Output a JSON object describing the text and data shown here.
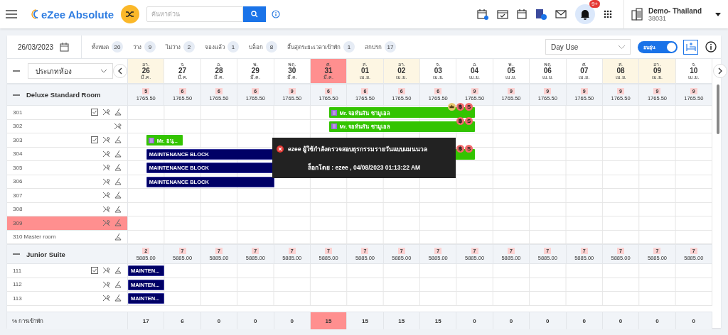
{
  "header": {
    "logo": "eZee Absolute",
    "search": {
      "placeholder": "ค้นหาด่วน"
    },
    "notifications": "9+",
    "property": {
      "name": "Demo- Thailand",
      "code": "38031"
    }
  },
  "toolbar": {
    "date": "26/03/2023",
    "stats": [
      {
        "label": "ทั้งหมด",
        "count": "20"
      },
      {
        "label": "ว่าง",
        "count": "9"
      },
      {
        "label": "ไม่ว่าง",
        "count": "2"
      },
      {
        "label": "จองแล้ว",
        "count": "1"
      },
      {
        "label": "บล็อก",
        "count": "8"
      },
      {
        "label": "สิ้นสุดระยะเวลาเข้าพัก",
        "count": "1"
      },
      {
        "label": "สกปรก",
        "count": "17"
      }
    ],
    "view": "Day Use",
    "toggle": {
      "label": "อบอุ่น",
      "on": true
    }
  },
  "room_type_filter": "ประเภทห้อง",
  "days": [
    {
      "dow": "อา.",
      "day": "26",
      "month": "มี.ค.",
      "weekend": true,
      "highlighted": false
    },
    {
      "dow": "จ.",
      "day": "27",
      "month": "มี.ค.",
      "weekend": false,
      "highlighted": false
    },
    {
      "dow": "อ.",
      "day": "28",
      "month": "มี.ค.",
      "weekend": false,
      "highlighted": false
    },
    {
      "dow": "พ.",
      "day": "29",
      "month": "มี.ค.",
      "weekend": false,
      "highlighted": false
    },
    {
      "dow": "พฤ.",
      "day": "30",
      "month": "มี.ค.",
      "weekend": false,
      "highlighted": false
    },
    {
      "dow": "ศ.",
      "day": "31",
      "month": "มี.ค.",
      "weekend": false,
      "highlighted": true
    },
    {
      "dow": "ส.",
      "day": "01",
      "month": "เม.ย.",
      "weekend": true,
      "highlighted": false
    },
    {
      "dow": "อา.",
      "day": "02",
      "month": "เม.ย.",
      "weekend": true,
      "highlighted": false
    },
    {
      "dow": "จ.",
      "day": "03",
      "month": "เม.ย.",
      "weekend": false,
      "highlighted": false
    },
    {
      "dow": "อ.",
      "day": "04",
      "month": "เม.ย.",
      "weekend": false,
      "highlighted": false
    },
    {
      "dow": "พ.",
      "day": "05",
      "month": "เม.ย.",
      "weekend": false,
      "highlighted": false
    },
    {
      "dow": "พฤ.",
      "day": "06",
      "month": "เม.ย.",
      "weekend": false,
      "highlighted": false
    },
    {
      "dow": "ศ.",
      "day": "07",
      "month": "เม.ย.",
      "weekend": false,
      "highlighted": false
    },
    {
      "dow": "ส.",
      "day": "08",
      "month": "เม.ย.",
      "weekend": true,
      "highlighted": false
    },
    {
      "dow": "อา.",
      "day": "09",
      "month": "เม.ย.",
      "weekend": true,
      "highlighted": false
    },
    {
      "dow": "จ.",
      "day": "10",
      "month": "เม.ย.",
      "weekend": false,
      "highlighted": false
    }
  ],
  "sections": [
    {
      "name": "Deluxe Standard Room",
      "expanded": true,
      "availability": [
        {
          "count": "5",
          "rate": "1765.50"
        },
        {
          "count": "6",
          "rate": "1765.50"
        },
        {
          "count": "6",
          "rate": "1765.50"
        },
        {
          "count": "6",
          "rate": "1765.50"
        },
        {
          "count": "9",
          "rate": "1765.50"
        },
        {
          "count": "6",
          "rate": "1765.50"
        },
        {
          "count": "6",
          "rate": "1765.50"
        },
        {
          "count": "6",
          "rate": "1765.50"
        },
        {
          "count": "6",
          "rate": "1765.50"
        },
        {
          "count": "9",
          "rate": "1765.50"
        },
        {
          "count": "9",
          "rate": "1765.50"
        },
        {
          "count": "9",
          "rate": "1765.50"
        },
        {
          "count": "9",
          "rate": "1765.50"
        },
        {
          "count": "9",
          "rate": "1765.50"
        },
        {
          "count": "9",
          "rate": "1765.50"
        },
        {
          "count": "9",
          "rate": "1765.50"
        }
      ],
      "rooms": [
        {
          "number": "301",
          "task_icon": true,
          "service_icon": true,
          "clean_icon": true,
          "highlighted": false,
          "bookings": [
            {
              "kind": "guest",
              "label": "Mr. จอห์นสัน ซามูเอล",
              "badges": [
                {
                  "kind": "crown"
                },
                {
                  "kind": "text",
                  "text": "฿"
                },
                {
                  "kind": "text",
                  "text": "S"
                }
              ]
            }
          ]
        },
        {
          "number": "302",
          "task_icon": false,
          "service_icon": true,
          "clean_icon": false,
          "highlighted": false,
          "bookings": [
            {
              "kind": "guest",
              "label": "Mr. จอห์นสัน ซามูเอล",
              "badges": [
                {
                  "kind": "text",
                  "text": "฿"
                },
                {
                  "kind": "text",
                  "text": "S"
                }
              ]
            }
          ]
        },
        {
          "number": "303",
          "task_icon": true,
          "service_icon": true,
          "clean_icon": true,
          "highlighted": false,
          "bookings": [
            {
              "kind": "guest",
              "label": "Mr. อนุ..."
            }
          ]
        },
        {
          "number": "304",
          "task_icon": false,
          "service_icon": true,
          "clean_icon": true,
          "highlighted": false,
          "bookings": [
            {
              "kind": "block",
              "label": "MAINTENANCE BLOCK"
            },
            {
              "kind": "guest",
              "badges": [
                {
                  "kind": "text",
                  "text": "฿"
                },
                {
                  "kind": "text",
                  "text": "S"
                }
              ]
            }
          ]
        },
        {
          "number": "305",
          "task_icon": false,
          "service_icon": true,
          "clean_icon": true,
          "highlighted": false,
          "bookings": [
            {
              "kind": "block",
              "label": "MAINTENANCE BLOCK"
            }
          ]
        },
        {
          "number": "306",
          "task_icon": false,
          "service_icon": true,
          "clean_icon": true,
          "highlighted": false,
          "bookings": [
            {
              "kind": "block",
              "label": "MAINTENANCE BLOCK"
            }
          ]
        },
        {
          "number": "307",
          "task_icon": false,
          "service_icon": true,
          "clean_icon": true,
          "highlighted": false
        },
        {
          "number": "308",
          "task_icon": false,
          "service_icon": true,
          "clean_icon": true,
          "highlighted": false
        },
        {
          "number": "309",
          "task_icon": false,
          "service_icon": true,
          "clean_icon": true,
          "highlighted": true
        },
        {
          "number": "310 Master room",
          "task_icon": false,
          "service_icon": false,
          "clean_icon": true,
          "highlighted": false
        }
      ]
    },
    {
      "name": "Junior Suite",
      "expanded": true,
      "availability": [
        {
          "count": "2",
          "rate": "5885.00"
        },
        {
          "count": "7",
          "rate": "5885.00"
        },
        {
          "count": "7",
          "rate": "5885.00"
        },
        {
          "count": "7",
          "rate": "5885.00"
        },
        {
          "count": "7",
          "rate": "5885.00"
        },
        {
          "count": "7",
          "rate": "5885.00"
        },
        {
          "count": "7",
          "rate": "5885.00"
        },
        {
          "count": "7",
          "rate": "5885.00"
        },
        {
          "count": "7",
          "rate": "5885.00"
        },
        {
          "count": "7",
          "rate": "5885.00"
        },
        {
          "count": "7",
          "rate": "5885.00"
        },
        {
          "count": "7",
          "rate": "5885.00"
        },
        {
          "count": "7",
          "rate": "5885.00"
        },
        {
          "count": "7",
          "rate": "5885.00"
        },
        {
          "count": "7",
          "rate": "5885.00"
        },
        {
          "count": "7",
          "rate": "5885.00"
        }
      ],
      "rooms": [
        {
          "number": "111",
          "task_icon": true,
          "service_icon": true,
          "clean_icon": true,
          "highlighted": false,
          "bookings": [
            {
              "kind": "block",
              "label": "MAINTEN..."
            }
          ]
        },
        {
          "number": "112",
          "task_icon": false,
          "service_icon": true,
          "clean_icon": true,
          "highlighted": false,
          "bookings": [
            {
              "kind": "block",
              "label": "MAINTEN..."
            }
          ]
        },
        {
          "number": "113",
          "task_icon": false,
          "service_icon": true,
          "clean_icon": true,
          "highlighted": false,
          "bookings": [
            {
              "kind": "block",
              "label": "MAINTEN..."
            }
          ]
        }
      ]
    }
  ],
  "tooltip": {
    "title": "ezee ผู้ใช้กำลังตรวจสอบธุรกรรมรายวันแบบแมนนวล",
    "detail": "ล็อกโดย : ezee , 04/08/2023 01:13:22 AM"
  },
  "footer": {
    "label": "% การเข้าพัก",
    "values": [
      {
        "value": "17",
        "highlighted": false
      },
      {
        "value": "6",
        "highlighted": false
      },
      {
        "value": "0",
        "highlighted": false
      },
      {
        "value": "0",
        "highlighted": false
      },
      {
        "value": "0",
        "highlighted": false
      },
      {
        "value": "15",
        "highlighted": true
      },
      {
        "value": "15",
        "highlighted": false
      },
      {
        "value": "15",
        "highlighted": false
      },
      {
        "value": "15",
        "highlighted": false
      },
      {
        "value": "0",
        "highlighted": false
      },
      {
        "value": "0",
        "highlighted": false
      },
      {
        "value": "0",
        "highlighted": false
      },
      {
        "value": "0",
        "highlighted": false
      },
      {
        "value": "0",
        "highlighted": false
      },
      {
        "value": "0",
        "highlighted": false
      },
      {
        "value": "0",
        "highlighted": false
      }
    ]
  }
}
